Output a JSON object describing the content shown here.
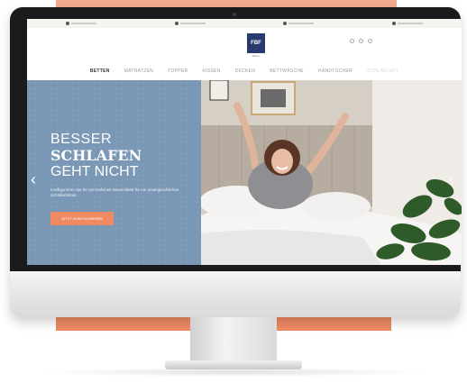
{
  "brand": {
    "logo_text": "FBF",
    "logo_sub": "Betten"
  },
  "nav": {
    "items": [
      {
        "label": "BETTEN"
      },
      {
        "label": "MATRATZEN"
      },
      {
        "label": "TOPPER"
      },
      {
        "label": "KISSEN"
      },
      {
        "label": "DECKEN"
      },
      {
        "label": "BETTWÄSCHE"
      },
      {
        "label": "HANDTÜCHER"
      },
      {
        "label": "SCHLAFLUFT"
      }
    ]
  },
  "hero": {
    "headline_1": "BESSER",
    "headline_2": "SCHLAFEN",
    "headline_3": "GEHT NICHT",
    "subtext": "Konfigurieren Sie Ihr persönliches Wunschbett für ein unvergleichliches Schlaferlebnis.",
    "cta_label": "JETZT KONFIGURIEREN"
  },
  "colors": {
    "accent": "#f08a62",
    "hero_blue": "#7a98b5",
    "logo_navy": "#2a3a6e"
  },
  "icons": [
    "chevron-left-icon",
    "chevron-right-icon",
    "search-icon",
    "account-icon",
    "cart-icon"
  ]
}
